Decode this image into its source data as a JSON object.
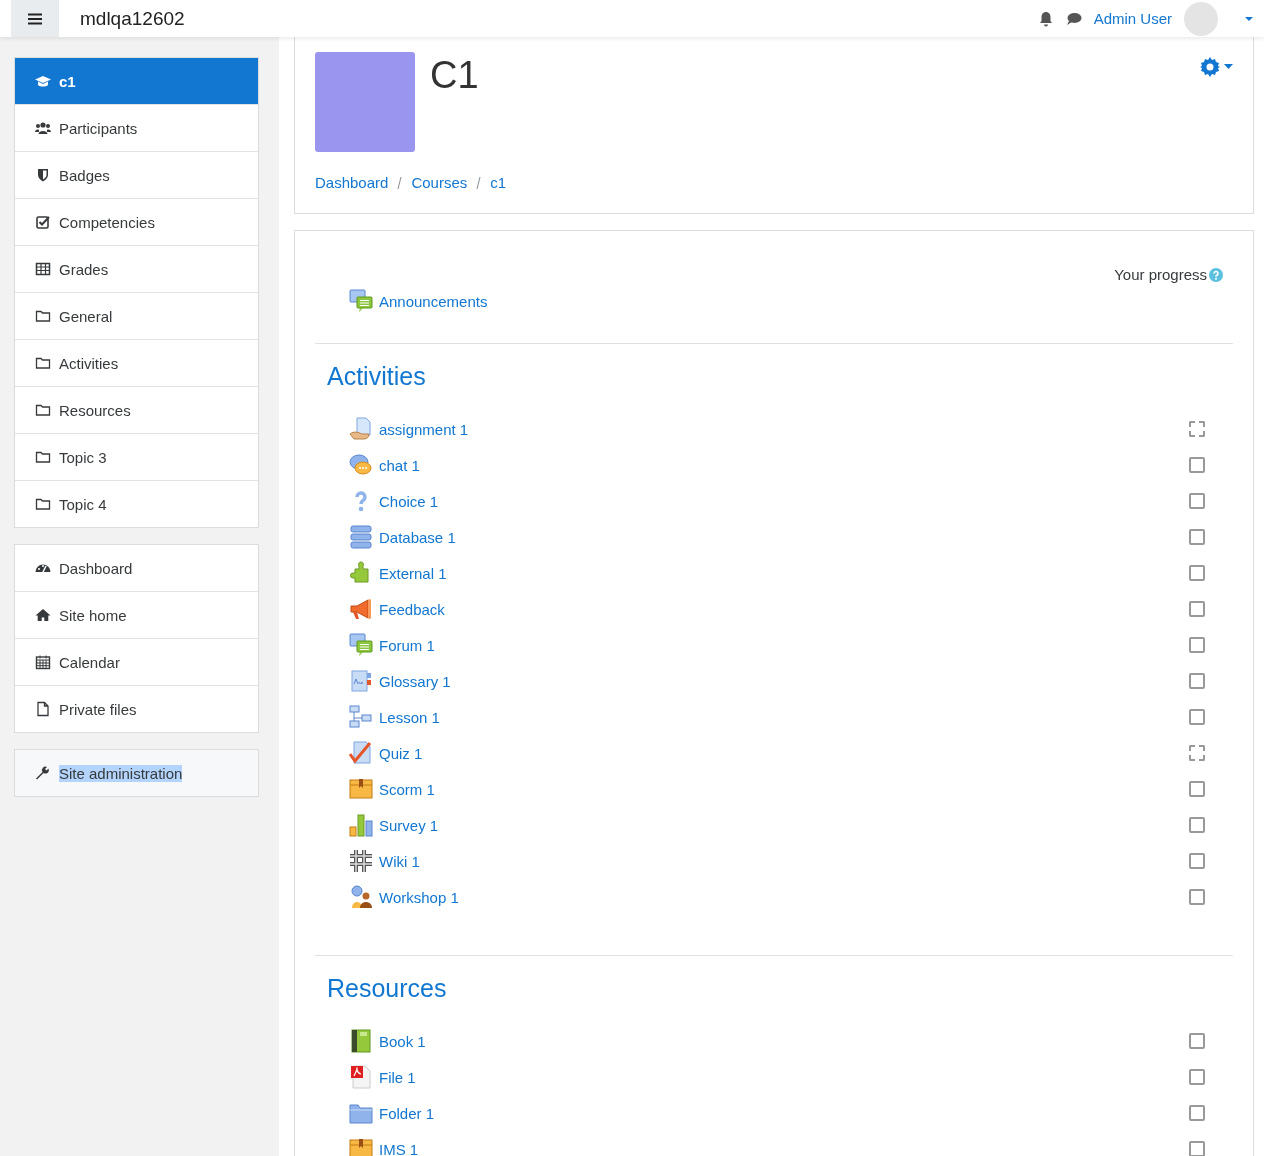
{
  "navbar": {
    "site_name": "mdlqa12602",
    "user_name": "Admin User"
  },
  "sidebar": {
    "groups": [
      {
        "items": [
          {
            "label": "c1",
            "selected": true
          },
          {
            "label": "Participants",
            "selected": false
          },
          {
            "label": "Badges",
            "selected": false
          },
          {
            "label": "Competencies",
            "selected": false
          },
          {
            "label": "Grades",
            "selected": false
          },
          {
            "label": "General",
            "selected": false
          },
          {
            "label": "Activities",
            "selected": false
          },
          {
            "label": "Resources",
            "selected": false
          },
          {
            "label": "Topic 3",
            "selected": false
          },
          {
            "label": "Topic 4",
            "selected": false
          }
        ]
      },
      {
        "items": [
          {
            "label": "Dashboard",
            "selected": false
          },
          {
            "label": "Site home",
            "selected": false
          },
          {
            "label": "Calendar",
            "selected": false
          },
          {
            "label": "Private files",
            "selected": false
          }
        ]
      },
      {
        "items": [
          {
            "label": "Site administration",
            "selected": false,
            "highlighted": true
          }
        ]
      }
    ]
  },
  "course": {
    "title": "C1",
    "breadcrumb": [
      "Dashboard",
      "Courses",
      "c1"
    ]
  },
  "progress_label": "Your progress",
  "intro": [
    {
      "name": "Announcements",
      "kind": "forum"
    }
  ],
  "sections": [
    {
      "title": "Activities",
      "items": [
        {
          "name": "assignment 1",
          "kind": "assign",
          "automatic": true,
          "checked": false
        },
        {
          "name": "chat 1",
          "kind": "chat",
          "automatic": false,
          "checked": false
        },
        {
          "name": "Choice 1",
          "kind": "choice",
          "automatic": false,
          "checked": false
        },
        {
          "name": "Database 1",
          "kind": "data",
          "automatic": false,
          "checked": false
        },
        {
          "name": "External 1",
          "kind": "lti",
          "automatic": false,
          "checked": false
        },
        {
          "name": "Feedback",
          "kind": "feedback",
          "automatic": false,
          "checked": false
        },
        {
          "name": "Forum 1",
          "kind": "forum",
          "automatic": false,
          "checked": false
        },
        {
          "name": "Glossary 1",
          "kind": "glossary",
          "automatic": false,
          "checked": false
        },
        {
          "name": "Lesson 1",
          "kind": "lesson",
          "automatic": false,
          "checked": false
        },
        {
          "name": "Quiz 1",
          "kind": "quiz",
          "automatic": true,
          "checked": false
        },
        {
          "name": "Scorm 1",
          "kind": "scorm",
          "automatic": false,
          "checked": false
        },
        {
          "name": "Survey 1",
          "kind": "survey",
          "automatic": false,
          "checked": false
        },
        {
          "name": "Wiki 1",
          "kind": "wiki",
          "automatic": false,
          "checked": false
        },
        {
          "name": "Workshop 1",
          "kind": "workshop",
          "automatic": false,
          "checked": false
        }
      ]
    },
    {
      "title": "Resources",
      "items": [
        {
          "name": "Book 1",
          "kind": "book",
          "automatic": false,
          "checked": false
        },
        {
          "name": "File 1",
          "kind": "pdf",
          "automatic": false,
          "checked": false
        },
        {
          "name": "Folder 1",
          "kind": "folder",
          "automatic": false,
          "checked": false
        },
        {
          "name": "IMS 1",
          "kind": "scorm",
          "automatic": false,
          "checked": false
        }
      ]
    }
  ]
}
